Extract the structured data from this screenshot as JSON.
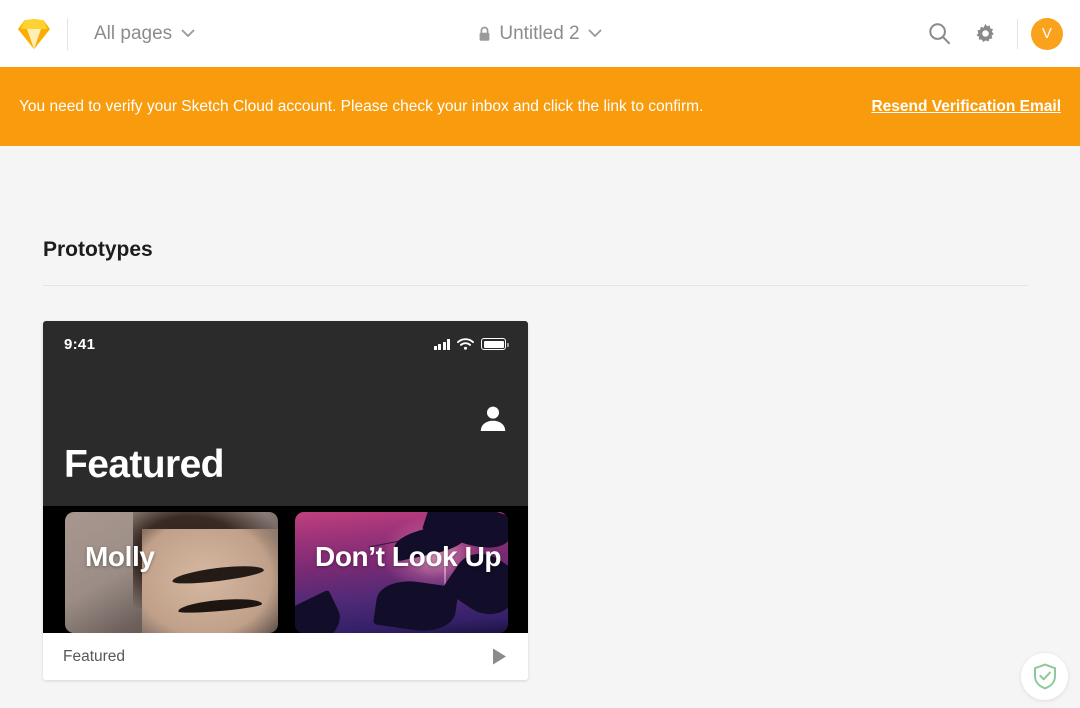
{
  "app": {
    "logo_icon": "sketch-diamond-logo",
    "accent_color": "#f89c0e",
    "avatar_color": "#faa21b",
    "page_background": "#f5f5f5"
  },
  "topbar": {
    "pages_label": "All pages",
    "pages_chevron_icon": "chevron-down-icon",
    "lock_icon": "lock-icon",
    "document_title": "Untitled 2",
    "title_chevron_icon": "chevron-down-icon",
    "search_icon": "search-icon",
    "settings_icon": "gear-icon",
    "avatar_initial": "V"
  },
  "banner": {
    "message": "You need to verify your Sketch Cloud account. Please check your inbox and click the link to confirm.",
    "action_label": "Resend Verification Email",
    "background_color": "#f89c0e"
  },
  "main": {
    "section_title": "Prototypes"
  },
  "prototype_card": {
    "footer_label": "Featured",
    "play_icon": "play-icon",
    "preview": {
      "status_bar": {
        "time": "9:41",
        "signal_icon": "cellular-signal-icon",
        "wifi_icon": "wifi-icon",
        "battery_icon": "battery-icon"
      },
      "profile_icon": "person-icon",
      "heading": "Featured",
      "tiles": [
        {
          "title": "Molly",
          "artwork": "portrait-photo-artwork"
        },
        {
          "title": "Don’t Look Up",
          "artwork": "purple-forest-artwork"
        }
      ]
    }
  },
  "overlay": {
    "shield_badge_icon": "shield-check-icon",
    "shield_color": "#84c88f"
  }
}
